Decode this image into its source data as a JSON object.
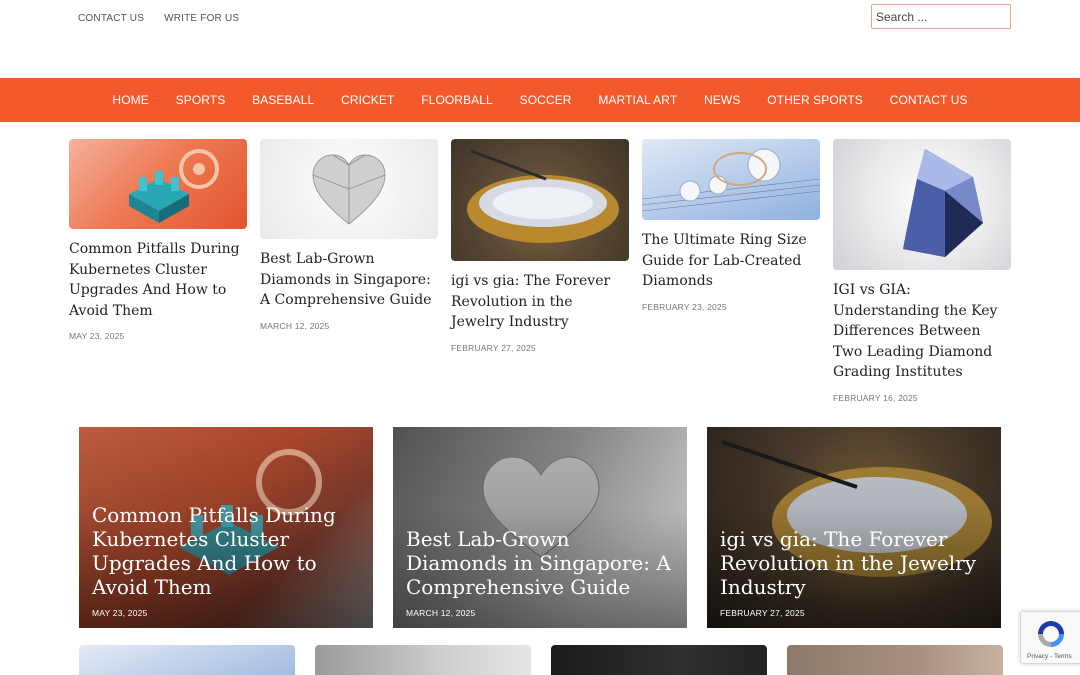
{
  "header": {
    "top_links": [
      {
        "label": "CONTACT US"
      },
      {
        "label": "WRITE FOR US"
      }
    ],
    "search": {
      "placeholder": "Search ..."
    }
  },
  "nav": {
    "items": [
      {
        "label": "HOME"
      },
      {
        "label": "SPORTS"
      },
      {
        "label": "BASEBALL"
      },
      {
        "label": "CRICKET"
      },
      {
        "label": "FLOORBALL"
      },
      {
        "label": "SOCCER"
      },
      {
        "label": "MARTIAL ART"
      },
      {
        "label": "NEWS"
      },
      {
        "label": "OTHER SPORTS"
      },
      {
        "label": "CONTACT US"
      }
    ],
    "background": "#f4592b"
  },
  "recent_posts": [
    {
      "title": "Common Pitfalls During Kubernetes Cluster Upgrades And How to Avoid Them",
      "date": "MAY 23, 2025",
      "image": "kubernetes-illustration"
    },
    {
      "title": "Best Lab-Grown Diamonds in Singapore: A Comprehensive Guide",
      "date": "MARCH 12, 2025",
      "image": "heart-diamond"
    },
    {
      "title": "igi vs gia: The Forever Revolution in the Jewelry Industry",
      "date": "FEBRUARY 27, 2025",
      "image": "diamonds-in-gold-bowl"
    },
    {
      "title": "The Ultimate Ring Size Guide for Lab-Created Diamonds",
      "date": "FEBRUARY 23, 2025",
      "image": "rings-on-sheet-music"
    },
    {
      "title": "IGI vs GIA: Understanding the Key Differences Between Two Leading Diamond Grading Institutes",
      "date": "FEBRUARY 16, 2025",
      "image": "round-diamond"
    }
  ],
  "featured_posts": [
    {
      "title": "Common Pitfalls During Kubernetes Cluster Upgrades And How to Avoid Them",
      "date": "MAY 23, 2025"
    },
    {
      "title": "Best Lab-Grown Diamonds in Singapore: A Comprehensive Guide",
      "date": "MARCH 12, 2025"
    },
    {
      "title": "igi vs gia: The Forever Revolution in the Jewelry Industry",
      "date": "FEBRUARY 27, 2025"
    }
  ],
  "recaptcha": {
    "text": "Privacy - Terms"
  }
}
